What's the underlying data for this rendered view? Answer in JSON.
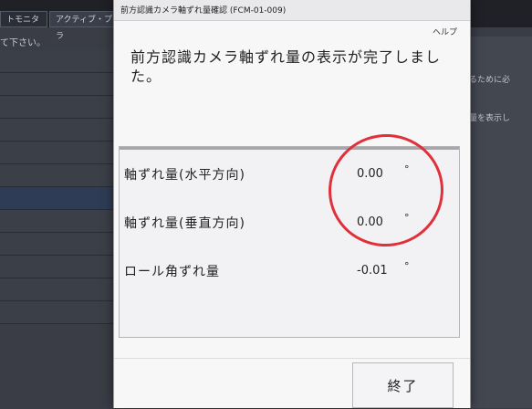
{
  "background_app": {
    "tabs": [
      "トモニタ",
      "アクティブ・プラ"
    ],
    "hint_text": "て下さい。",
    "right_text_1": "するために必",
    "right_text_2": "れ量を表示し"
  },
  "dialog": {
    "title": "前方認識カメラ軸ずれ量確認 (FCM-01-009)",
    "help_label": "ヘルプ",
    "message": "前方認識カメラ軸ずれ量の表示が完了しました。",
    "rows": [
      {
        "label": "軸ずれ量(水平方向)",
        "value": "0.00",
        "unit": "°"
      },
      {
        "label": "軸ずれ量(垂直方向)",
        "value": "0.00",
        "unit": "°"
      },
      {
        "label": "ロール角ずれ量",
        "value": "-0.01",
        "unit": "°"
      }
    ],
    "end_button_label": "終了"
  },
  "colors": {
    "highlight_circle": "#e0303a"
  }
}
